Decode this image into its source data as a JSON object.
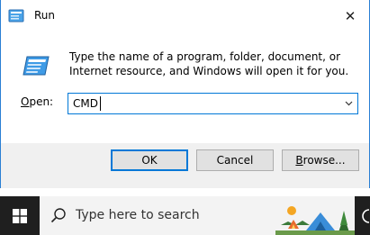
{
  "window": {
    "title": "Run",
    "close_glyph": "✕"
  },
  "dialog": {
    "description": "Type the name of a program, folder, document, or Internet resource, and Windows will open it for you.",
    "open_label_underlined": "O",
    "open_label_rest": "pen:",
    "open_value": "CMD"
  },
  "buttons": {
    "ok_label": "OK",
    "cancel_label": "Cancel",
    "browse_underlined": "B",
    "browse_rest": "rowse..."
  },
  "taskbar": {
    "search_placeholder": "Type here to search"
  },
  "icons": {
    "app": "run-app-icon",
    "run": "run-dialog-icon",
    "close": "close-icon",
    "dropdown": "chevron-down-icon",
    "start": "windows-logo-icon",
    "search": "search-icon",
    "task_view": "task-view-icon"
  },
  "colors": {
    "accent": "#0078d7",
    "taskbar": "#1f1f1f",
    "search_box": "#f3f3f3"
  }
}
